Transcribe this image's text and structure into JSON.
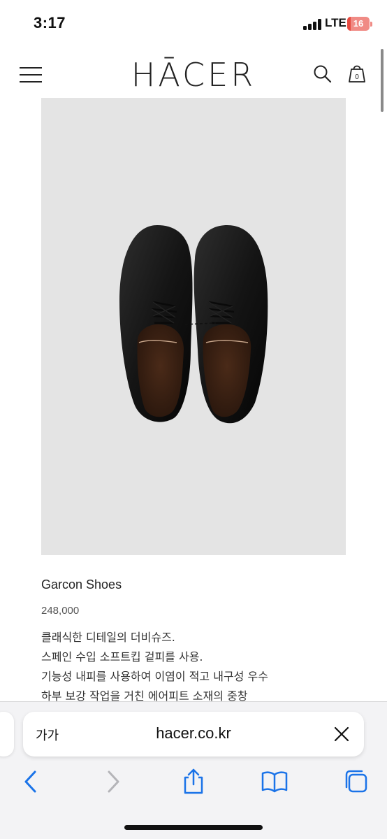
{
  "status_bar": {
    "time": "3:17",
    "network": "LTE",
    "battery_level": "16",
    "battery_fraction": 0.16
  },
  "header": {
    "logo_text": "HĀCER",
    "cart_count": "0",
    "icons": [
      "menu-icon",
      "search-icon",
      "shopping-bag-icon"
    ]
  },
  "product": {
    "name": "Garcon Shoes",
    "price": "248,000",
    "description": [
      "클래식한 디테일의 더비슈즈.",
      "스페인 수입 소프트킵 겉피를 사용.",
      "기능성 내피를 사용하여 이염이 적고 내구성 우수",
      "하부 보강 작업을 거친 에어피트 소재의 중창"
    ]
  },
  "browser": {
    "text_size_label": "가가",
    "url": "hacer.co.kr",
    "toolbar_icons": [
      "back-icon",
      "forward-icon",
      "share-icon",
      "bookmarks-icon",
      "tabs-icon"
    ]
  },
  "colors": {
    "image_background": "#e4e4e4",
    "safari_accent": "#1a73e8",
    "battery_low": "#e84a3f"
  }
}
